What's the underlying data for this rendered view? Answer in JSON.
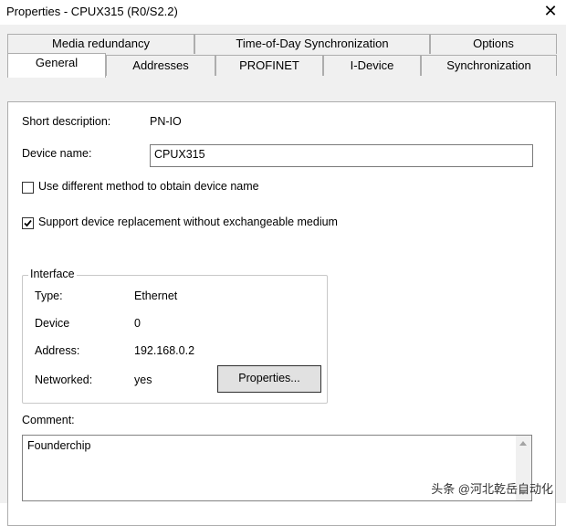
{
  "window": {
    "title": "Properties - CPUX315 (R0/S2.2)",
    "close_glyph": "✕"
  },
  "tabs": {
    "back_row": [
      {
        "label": "Media redundancy"
      },
      {
        "label": "Time-of-Day Synchronization"
      },
      {
        "label": "Options"
      }
    ],
    "front_row": [
      {
        "label": "General",
        "selected": true
      },
      {
        "label": "Addresses"
      },
      {
        "label": "PROFINET"
      },
      {
        "label": "I-Device"
      },
      {
        "label": "Synchronization"
      }
    ]
  },
  "general": {
    "short_description_label": "Short description:",
    "short_description_value": "PN-IO",
    "device_name_label": "Device name:",
    "device_name_value": "CPUX315",
    "option_different_method": {
      "label": "Use different method to obtain device name",
      "checked": false
    },
    "option_support_replacement": {
      "label": "Support device replacement without exchangeable medium",
      "checked": true
    }
  },
  "interface": {
    "legend": "Interface",
    "type_label": "Type:",
    "type_value": "Ethernet",
    "device_label": "Device",
    "device_value": "0",
    "address_label": "Address:",
    "address_value": "192.168.0.2",
    "networked_label": "Networked:",
    "networked_value": "yes",
    "properties_button": "Properties..."
  },
  "comment": {
    "label": "Comment:",
    "value": "Founderchip"
  },
  "watermark": "头条 @河北乾岳自动化"
}
